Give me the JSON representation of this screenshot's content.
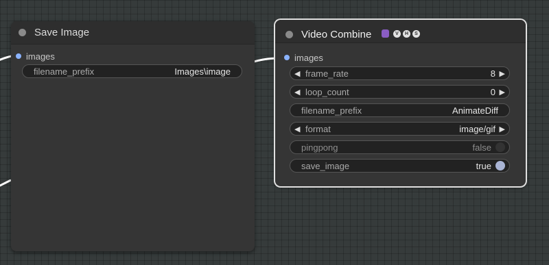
{
  "save_image_node": {
    "title": "Save Image",
    "input_label": "images",
    "filename_prefix": {
      "label": "filename_prefix",
      "value": "Images\\image"
    }
  },
  "video_combine_node": {
    "title": "Video Combine",
    "badge_letters": [
      "V",
      "H",
      "S"
    ],
    "input_label": "images",
    "frame_rate": {
      "label": "frame_rate",
      "value": "8"
    },
    "loop_count": {
      "label": "loop_count",
      "value": "0"
    },
    "filename_prefix": {
      "label": "filename_prefix",
      "value": "AnimateDiff"
    },
    "format": {
      "label": "format",
      "value": "image/gif"
    },
    "pingpong": {
      "label": "pingpong",
      "value": "false"
    },
    "save_image": {
      "label": "save_image",
      "value": "true"
    }
  },
  "colors": {
    "canvas": "#363b3b",
    "node_body": "#353535",
    "node_title": "#2e2e2e",
    "slot_image": "#8bb3ff",
    "link": "#ffffff",
    "selected_outline": "#e0e0e0"
  }
}
